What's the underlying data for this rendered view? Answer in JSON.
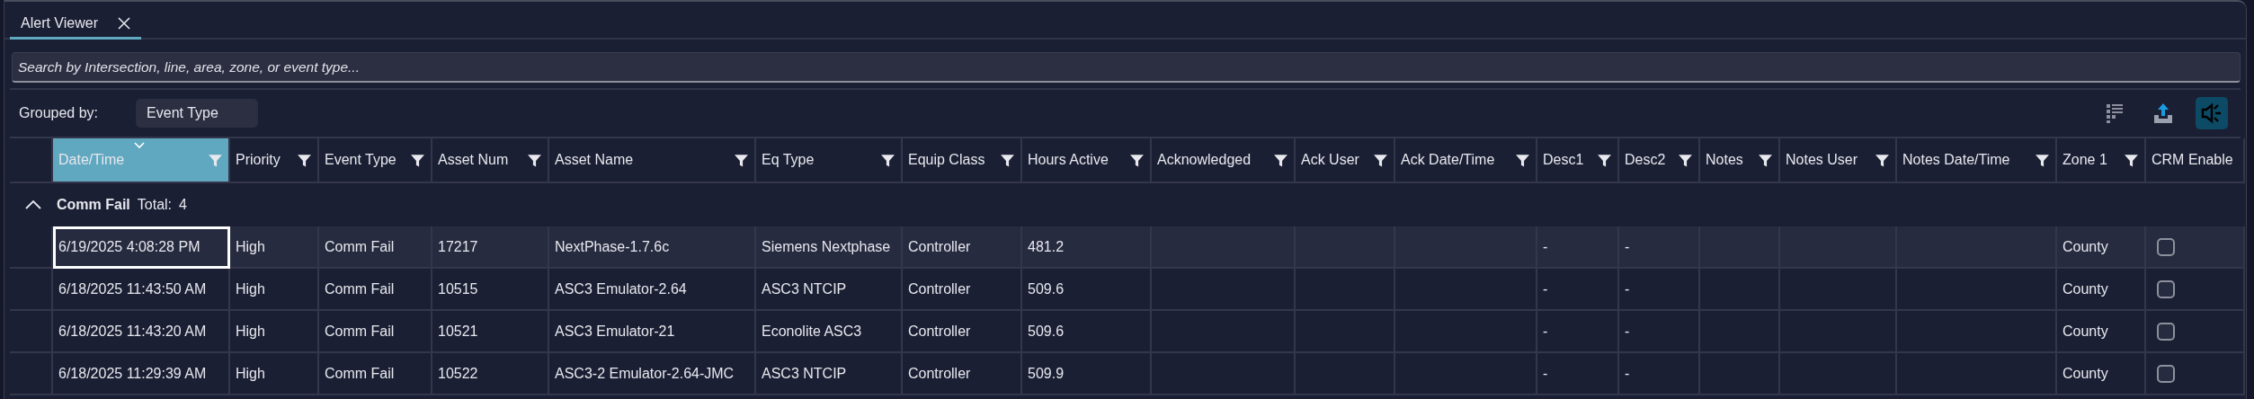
{
  "tab": {
    "label": "Alert Viewer",
    "selected": true
  },
  "search": {
    "placeholder": "Search by Intersection, line, area, zone, or event type..."
  },
  "grouped_by": {
    "label": "Grouped by:",
    "value": "Event Type"
  },
  "toolbar": [
    {
      "kind": "columns"
    },
    {
      "kind": "export"
    },
    {
      "kind": "sound",
      "on": true
    }
  ],
  "columns": [
    {
      "label": "Date/Time",
      "selected": true,
      "filter": true
    },
    {
      "label": "Priority",
      "selected": false,
      "filter": true
    },
    {
      "label": "Event Type",
      "selected": false,
      "filter": true
    },
    {
      "label": "Asset Num",
      "selected": false,
      "filter": true
    },
    {
      "label": "Asset Name",
      "selected": false,
      "filter": true
    },
    {
      "label": "Eq Type",
      "selected": false,
      "filter": true
    },
    {
      "label": "Equip Class",
      "selected": false,
      "filter": true
    },
    {
      "label": "Hours Active",
      "selected": false,
      "filter": true
    },
    {
      "label": "Acknowledged",
      "selected": false,
      "filter": true
    },
    {
      "label": "Ack User",
      "selected": false,
      "filter": true
    },
    {
      "label": "Ack Date/Time",
      "selected": false,
      "filter": true
    },
    {
      "label": "Desc1",
      "selected": false,
      "filter": true
    },
    {
      "label": "Desc2",
      "selected": false,
      "filter": true
    },
    {
      "label": "Notes",
      "selected": false,
      "filter": true
    },
    {
      "label": "Notes User",
      "selected": false,
      "filter": true
    },
    {
      "label": "Notes Date/Time",
      "selected": false,
      "filter": true
    },
    {
      "label": "Zone 1",
      "selected": false,
      "filter": true
    },
    {
      "label": "CRM Enable",
      "selected": false,
      "filter": false
    }
  ],
  "group": {
    "expanded": true,
    "name": "Comm Fail",
    "total_label": "Total:",
    "count": "4"
  },
  "rows": [
    {
      "selected": true,
      "crm_enabled": false,
      "cells": [
        "6/19/2025 4:08:28 PM",
        "High",
        "Comm Fail",
        "17217",
        "NextPhase-1.7.6c",
        "Siemens Nextphase",
        "Controller",
        "481.2",
        null,
        null,
        null,
        "-",
        "-",
        null,
        null,
        null,
        "County"
      ]
    },
    {
      "selected": false,
      "crm_enabled": false,
      "cells": [
        "6/18/2025 11:43:50 AM",
        "High",
        "Comm Fail",
        "10515",
        "ASC3 Emulator-2.64",
        "ASC3 NTCIP",
        "Controller",
        "509.6",
        null,
        null,
        null,
        "-",
        "-",
        null,
        null,
        null,
        "County"
      ]
    },
    {
      "selected": false,
      "crm_enabled": false,
      "cells": [
        "6/18/2025 11:43:20 AM",
        "High",
        "Comm Fail",
        "10521",
        "ASC3 Emulator-21",
        "Econolite ASC3",
        "Controller",
        "509.6",
        null,
        null,
        null,
        "-",
        "-",
        null,
        null,
        null,
        "County"
      ]
    },
    {
      "selected": false,
      "crm_enabled": false,
      "cells": [
        "6/18/2025 11:29:39 AM",
        "High",
        "Comm Fail",
        "10522",
        "ASC3-2 Emulator-2.64-JMC",
        "ASC3 NTCIP",
        "Controller",
        "509.9",
        null,
        null,
        null,
        "-",
        "-",
        null,
        null,
        null,
        "County"
      ]
    }
  ]
}
